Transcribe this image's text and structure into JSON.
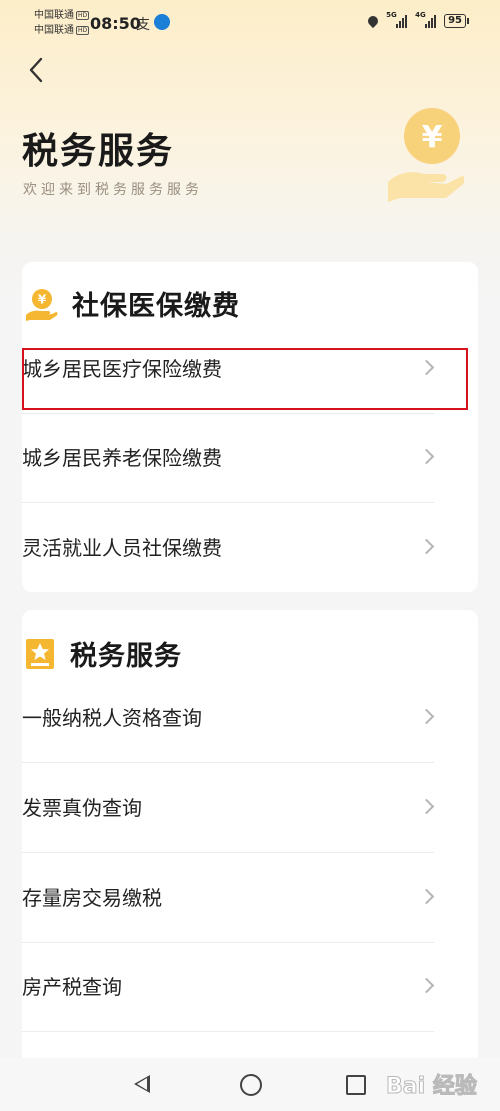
{
  "status_bar": {
    "carrier1": "中国联通",
    "carrier2": "中国联通",
    "hd": "HD",
    "time": "08:50",
    "net1": "5G",
    "net2": "4G",
    "battery": "95"
  },
  "header": {
    "title": "税务服务",
    "subtitle": "欢迎来到税务服务服务",
    "hero_icon": "yuan-hand-icon",
    "hero_symbol": "¥"
  },
  "sections": [
    {
      "title": "社保医保缴费",
      "icon": "coin-hand-icon",
      "items": [
        {
          "label": "城乡居民医疗保险缴费",
          "highlighted": true
        },
        {
          "label": "城乡居民养老保险缴费"
        },
        {
          "label": "灵活就业人员社保缴费"
        }
      ]
    },
    {
      "title": "税务服务",
      "icon": "star-badge-icon",
      "items": [
        {
          "label": "一般纳税人资格查询"
        },
        {
          "label": "发票真伪查询"
        },
        {
          "label": "存量房交易缴税"
        },
        {
          "label": "房产税查询"
        }
      ]
    }
  ],
  "highlight_color": "#d6121f",
  "accent_color": "#f5b731",
  "watermark": "Bai 经验"
}
